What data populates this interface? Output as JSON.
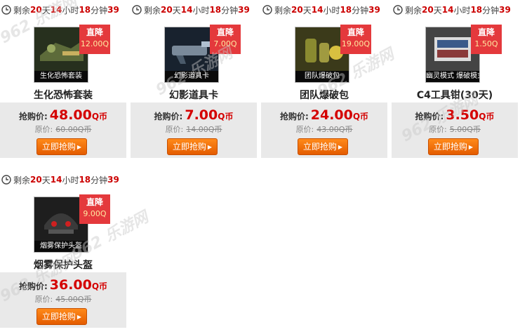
{
  "products": [
    {
      "countdown": {
        "prefix": "剩余",
        "days": "20",
        "days_unit": "天",
        "hours": "14",
        "hours_unit": "小时",
        "minutes": "18",
        "minutes_unit": "分钟",
        "seconds": "39"
      },
      "thumb_caption": "生化恐怖套装",
      "tag": {
        "title": "直降",
        "value": "12.00Q"
      },
      "name": "生化恐怖套装",
      "sale_label": "抢购价:",
      "sale_price": "48.00",
      "sale_unit": "Q币",
      "orig_label": "原价:",
      "orig_price": "60.00Q币",
      "buy_label": "立即抢购",
      "thumb_color": "#3a4a2a"
    },
    {
      "countdown": {
        "prefix": "剩余",
        "days": "20",
        "days_unit": "天",
        "hours": "14",
        "hours_unit": "小时",
        "minutes": "18",
        "minutes_unit": "分钟",
        "seconds": "39"
      },
      "thumb_caption": "幻影道具卡",
      "tag": {
        "title": "直降",
        "value": "7.00Q"
      },
      "name": "幻影道具卡",
      "sale_label": "抢购价:",
      "sale_price": "7.00",
      "sale_unit": "Q币",
      "orig_label": "原价:",
      "orig_price": "14.00Q币",
      "buy_label": "立即抢购",
      "thumb_color": "#1f2b3a"
    },
    {
      "countdown": {
        "prefix": "剩余",
        "days": "20",
        "days_unit": "天",
        "hours": "14",
        "hours_unit": "小时",
        "minutes": "18",
        "minutes_unit": "分钟",
        "seconds": "39"
      },
      "thumb_caption": "团队爆破包",
      "tag": {
        "title": "直降",
        "value": "19.00Q"
      },
      "name": "团队爆破包",
      "sale_label": "抢购价:",
      "sale_price": "24.00",
      "sale_unit": "Q币",
      "orig_label": "原价:",
      "orig_price": "43.00Q币",
      "buy_label": "立即抢购",
      "thumb_color": "#4a4a22"
    },
    {
      "countdown": {
        "prefix": "剩余",
        "days": "20",
        "days_unit": "天",
        "hours": "14",
        "hours_unit": "小时",
        "minutes": "18",
        "minutes_unit": "分钟",
        "seconds": "39"
      },
      "thumb_caption": "幽灵模式 爆破模式",
      "tag": {
        "title": "直降",
        "value": "1.50Q"
      },
      "name": "C4工具钳(30天)",
      "sale_label": "抢购价:",
      "sale_price": "3.50",
      "sale_unit": "Q币",
      "orig_label": "原价:",
      "orig_price": "5.00Q币",
      "buy_label": "立即抢购",
      "thumb_color": "#3a3a3a"
    },
    {
      "countdown": {
        "prefix": "剩余",
        "days": "20",
        "days_unit": "天",
        "hours": "14",
        "hours_unit": "小时",
        "minutes": "18",
        "minutes_unit": "分钟",
        "seconds": "39"
      },
      "thumb_caption": "烟雾保护头盔",
      "tag": {
        "title": "直降",
        "value": "9.00Q"
      },
      "name": "烟雾保护头盔",
      "sale_label": "抢购价:",
      "sale_price": "36.00",
      "sale_unit": "Q币",
      "orig_label": "原价:",
      "orig_price": "45.00Q币",
      "buy_label": "立即抢购",
      "thumb_color": "#2a2a2a"
    }
  ],
  "watermark": "962 乐游网",
  "colors": {
    "accent_red": "#d40000",
    "tag_red": "#e4393c",
    "button_orange": "#ff7a10",
    "panel_gray": "#e9e9e9"
  },
  "icons": {
    "countdown": "clock-icon",
    "buy": "arrow-right-icon"
  }
}
